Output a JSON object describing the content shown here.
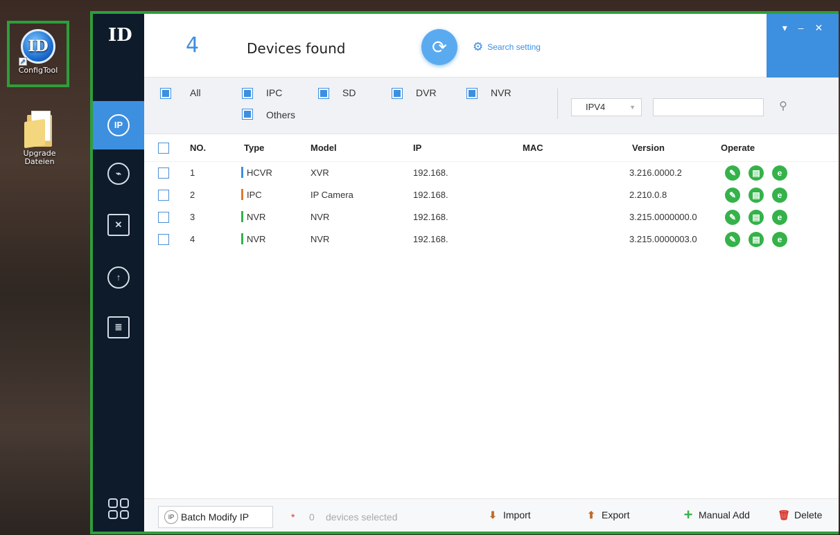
{
  "desktop": {
    "config_tool_label": "ConfigTool",
    "config_tool_logo": "ID",
    "upgrade_label_1": "Upgrade",
    "upgrade_label_2": "Dateien"
  },
  "sidebar": {
    "logo": "ID",
    "items": [
      {
        "name": "ip-icon",
        "glyph": "IP"
      },
      {
        "name": "camera-icon",
        "glyph": "⌁"
      },
      {
        "name": "tools-icon",
        "glyph": "✕"
      },
      {
        "name": "upgrade-icon",
        "glyph": "↑"
      },
      {
        "name": "document-icon",
        "glyph": "≣"
      }
    ],
    "bottom_icon": "apps-icon"
  },
  "header": {
    "count": "4",
    "found_label": "Devices found",
    "refresh_glyph": "⟳",
    "search_setting_label": "Search setting",
    "window_controls": {
      "menu": "▾",
      "minimize": "–",
      "close": "✕"
    }
  },
  "filters": {
    "all": "All",
    "ipc": "IPC",
    "sd": "SD",
    "dvr": "DVR",
    "nvr": "NVR",
    "others": "Others",
    "ip_version": "IPV4",
    "search_value": "",
    "search_placeholder": ""
  },
  "table": {
    "headers": {
      "no": "NO.",
      "type": "Type",
      "model": "Model",
      "ip": "IP",
      "mac": "MAC",
      "version": "Version",
      "operate": "Operate"
    },
    "rows": [
      {
        "no": "1",
        "type": "HCVR",
        "type_color": "#3d8fe0",
        "model": "XVR",
        "ip": "192.168.",
        "mac": "",
        "version": "3.216.0000.2"
      },
      {
        "no": "2",
        "type": "IPC",
        "type_color": "#e07a2b",
        "model": "IP Camera",
        "ip": "192.168.",
        "mac": "",
        "version": "2.210.0.8"
      },
      {
        "no": "3",
        "type": "NVR",
        "type_color": "#35b24a",
        "model": "NVR",
        "ip": "192.168.",
        "mac": "",
        "version": "3.215.0000000.0"
      },
      {
        "no": "4",
        "type": "NVR",
        "type_color": "#35b24a",
        "model": "NVR",
        "ip": "192.168.",
        "mac": "",
        "version": "3.215.0000003.0"
      }
    ],
    "operate_icons": [
      "edit-icon",
      "info-icon",
      "web-icon"
    ]
  },
  "footer": {
    "batch_modify": "Batch Modify IP",
    "batch_icon": "IP",
    "star": "*",
    "selected_count": "0",
    "selected_label": "devices selected",
    "import": "Import",
    "export": "Export",
    "manual_add": "Manual Add",
    "delete": "Delete"
  },
  "colors": {
    "accent": "#3d8fe0",
    "green": "#35b24a",
    "frame": "#2e9e3a",
    "sidebar": "#0d1b2b"
  }
}
